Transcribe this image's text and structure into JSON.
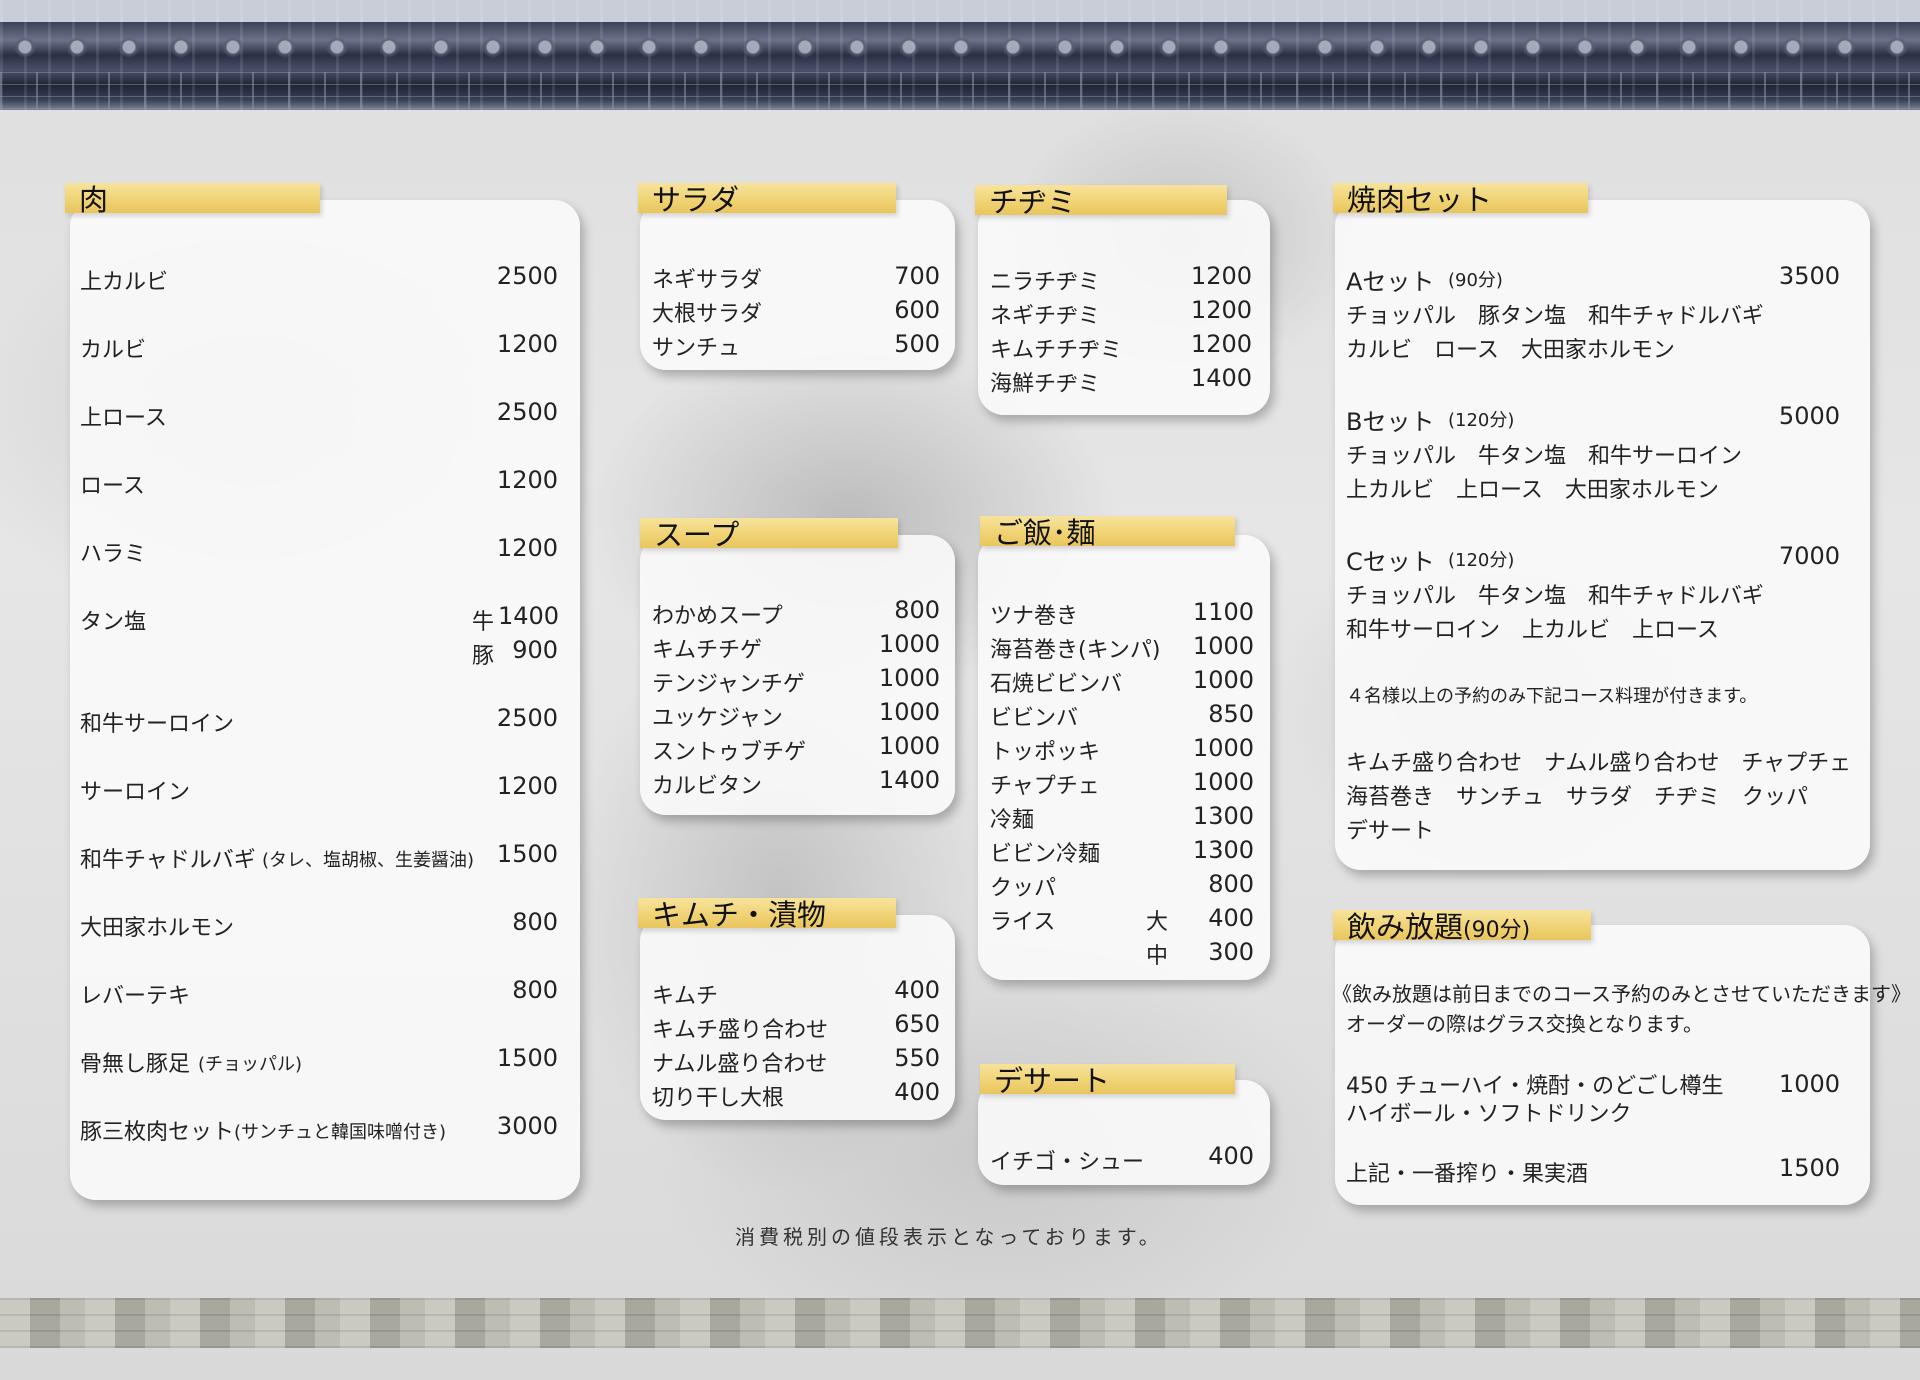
{
  "meat": {
    "title": "肉",
    "items": [
      {
        "name": "上カルビ",
        "price": "2500"
      },
      {
        "name": "カルビ",
        "price": "1200"
      },
      {
        "name": "上ロース",
        "price": "2500"
      },
      {
        "name": "ロース",
        "price": "1200"
      },
      {
        "name": "ハラミ",
        "price": "1200"
      },
      {
        "name": "タン塩",
        "price_gyu_label": "牛",
        "price_gyu": "1400",
        "price_buta_label": "豚",
        "price_buta": "900"
      },
      {
        "name": "和牛サーロイン",
        "price": "2500"
      },
      {
        "name": "サーロイン",
        "price": "1200"
      },
      {
        "name": "和牛チャドルバギ",
        "note": "(タレ、塩胡椒、生姜醤油)",
        "price": "1500"
      },
      {
        "name": "大田家ホルモン",
        "price": "800"
      },
      {
        "name": "レバーテキ",
        "price": "800"
      },
      {
        "name": "骨無し豚足",
        "note": "(チョッパル)",
        "price": "1500"
      },
      {
        "name": "豚三枚肉セット",
        "note": "(サンチュと韓国味噌付き)",
        "price": "3000"
      }
    ]
  },
  "salad": {
    "title": "サラダ",
    "items": [
      {
        "name": "ネギサラダ",
        "price": "700"
      },
      {
        "name": "大根サラダ",
        "price": "600"
      },
      {
        "name": "サンチュ",
        "price": "500"
      }
    ]
  },
  "chijimi": {
    "title": "チヂミ",
    "items": [
      {
        "name": "ニラチヂミ",
        "price": "1200"
      },
      {
        "name": "ネギチヂミ",
        "price": "1200"
      },
      {
        "name": "キムチチヂミ",
        "price": "1200"
      },
      {
        "name": "海鮮チヂミ",
        "price": "1400"
      }
    ]
  },
  "soup": {
    "title": "スープ",
    "items": [
      {
        "name": "わかめスープ",
        "price": "800"
      },
      {
        "name": "キムチチゲ",
        "price": "1000"
      },
      {
        "name": "テンジャンチゲ",
        "price": "1000"
      },
      {
        "name": "ユッケジャン",
        "price": "1000"
      },
      {
        "name": "スントゥブチゲ",
        "price": "1000"
      },
      {
        "name": "カルビタン",
        "price": "1400"
      }
    ]
  },
  "rice": {
    "title": "ご飯･麺",
    "items": [
      {
        "name": "ツナ巻き",
        "price": "1100"
      },
      {
        "name": "海苔巻き(キンパ)",
        "price": "1000"
      },
      {
        "name": "石焼ビビンバ",
        "price": "1000"
      },
      {
        "name": "ビビンバ",
        "price": "850"
      },
      {
        "name": "トッポッキ",
        "price": "1000"
      },
      {
        "name": "チャプチェ",
        "price": "1000"
      },
      {
        "name": "冷麺",
        "price": "1300"
      },
      {
        "name": "ビビン冷麺",
        "price": "1300"
      },
      {
        "name": "クッパ",
        "price": "800"
      }
    ],
    "rice_item": {
      "name": "ライス",
      "large_label": "大",
      "large_price": "400",
      "medium_label": "中",
      "medium_price": "300"
    }
  },
  "kimchi": {
    "title": "キムチ・漬物",
    "items": [
      {
        "name": "キムチ",
        "price": "400"
      },
      {
        "name": "キムチ盛り合わせ",
        "price": "650"
      },
      {
        "name": "ナムル盛り合わせ",
        "price": "550"
      },
      {
        "name": "切り干し大根",
        "price": "400"
      }
    ]
  },
  "dessert": {
    "title": "デサート",
    "items": [
      {
        "name": "イチゴ・シュー",
        "price": "400"
      }
    ]
  },
  "yakiniku_set": {
    "title": "焼肉セット",
    "sets": [
      {
        "name": "Aセット",
        "time": "(90分)",
        "price": "3500",
        "line1": "チョッパル　豚タン塩　和牛チャドルバギ",
        "line2": "カルビ　ロース　大田家ホルモン"
      },
      {
        "name": "Bセット",
        "time": "(120分)",
        "price": "5000",
        "line1": "チョッパル　牛タン塩　和牛サーロイン",
        "line2": "上カルビ　上ロース　大田家ホルモン"
      },
      {
        "name": "Cセット",
        "time": "(120分)",
        "price": "7000",
        "line1": "チョッパル　牛タン塩　和牛チャドルバギ",
        "line2": "和牛サーロイン　上カルビ　上ロース"
      }
    ],
    "course_note": "４名様以上の予約のみ下記コース料理が付きます。",
    "course_line1": "キムチ盛り合わせ　ナムル盛り合わせ　チャプチェ",
    "course_line2": "海苔巻き　サンチュ　サラダ　チヂミ　クッパ",
    "course_line3": "デサート"
  },
  "nomihoudai": {
    "title": "飲み放題",
    "title_time": "(90分)",
    "note1": "《飲み放題は前日までのコース予約のみとさせていただきます》",
    "note2": "オーダーの際はグラス交換となります。",
    "plan1_line1": "450 チューハイ・焼酎・のどごし樽生",
    "plan1_line2": "ハイボール・ソフトドリンク",
    "plan1_price": "1000",
    "plan2_line1": "上記・一番搾り・果実酒",
    "plan2_price": "1500"
  },
  "footer": "消費税別の値段表示となっております。"
}
